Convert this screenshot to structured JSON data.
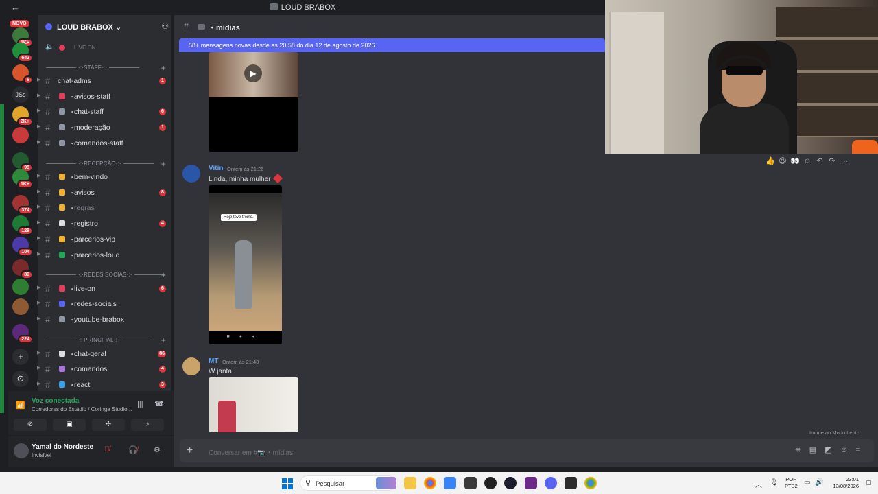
{
  "window": {
    "title": "LOUD BRABOX",
    "back_icon": "back-arrow-icon"
  },
  "rail": {
    "novo_label": "NOVO",
    "servers": [
      {
        "color": "#3c7a3e",
        "badge": "1K+"
      },
      {
        "color": "#1f8f3a",
        "badge": "642"
      },
      {
        "color": "#d8542a",
        "badge": "6"
      },
      {
        "color": "#e0a52a",
        "badge": "2K+"
      },
      {
        "color": "#c93a3a",
        "badge": ""
      },
      {
        "color": "#245a2f",
        "badge": "95"
      },
      {
        "color": "#2e8a3a",
        "badge": "1K+"
      },
      {
        "color": "#a13333",
        "badge": "374"
      },
      {
        "color": "#1f7a36",
        "badge": "128"
      },
      {
        "color": "#4b3aa8",
        "badge": "104"
      },
      {
        "color": "#7a2a2a",
        "badge": "80"
      },
      {
        "color": "#2e7d32",
        "badge": ""
      },
      {
        "color": "#8d5a34",
        "badge": ""
      },
      {
        "color": "#5b2a7a",
        "badge": "224"
      }
    ],
    "js_label": "JSs",
    "add_label": "+",
    "explore_label": "⊙"
  },
  "sidebar": {
    "server_name": "LOUD BRABOX",
    "live_on": "LIVE ON",
    "categories": [
      {
        "label": "STAFF"
      },
      {
        "label": "RECEPÇÃO"
      },
      {
        "label": "REDES SOCIAS"
      },
      {
        "label": "PRINCIPAL"
      }
    ],
    "channels": [
      {
        "label": "chat-adms",
        "count": "1",
        "emo": ""
      },
      {
        "label": "avisos-staff",
        "count": "",
        "emo": "#e23d5b"
      },
      {
        "label": "chat-staff",
        "count": "6",
        "emo": "#8f96a3"
      },
      {
        "label": "moderação",
        "count": "1",
        "emo": "#8f96a3"
      },
      {
        "label": "comandos-staff",
        "count": "",
        "emo": "#8f96a3"
      },
      {
        "label": "bem-vindo",
        "count": "",
        "emo": "#f0b232"
      },
      {
        "label": "avisos",
        "count": "8",
        "emo": "#f0b232"
      },
      {
        "label": "regras",
        "count": "",
        "emo": "#f0b232"
      },
      {
        "label": "registro",
        "count": "4",
        "emo": "#dbdee1"
      },
      {
        "label": "parcerios-vip",
        "count": "",
        "emo": "#f0b232"
      },
      {
        "label": "parcerios-loud",
        "count": "",
        "emo": "#23a55a"
      },
      {
        "label": "live-on",
        "count": "6",
        "emo": "#e23d5b"
      },
      {
        "label": "redes-sociais",
        "count": "",
        "emo": "#5865f2"
      },
      {
        "label": "youtube-brabox",
        "count": "",
        "emo": "#8f96a3"
      },
      {
        "label": "chat-geral",
        "count": "86",
        "emo": "#dbdee1"
      },
      {
        "label": "comandos",
        "count": "4",
        "emo": "#a974d8"
      },
      {
        "label": "react",
        "count": "3",
        "emo": "#3aa0e8"
      }
    ]
  },
  "voice": {
    "title": "Voz conectada",
    "subtitle": "Corredores do Estádio / Coringa Studio..."
  },
  "user": {
    "name": "Yamal do Nordeste",
    "status": "Invisível"
  },
  "main": {
    "channel_name": "mídias",
    "new_messages_banner": "58+ mensagens novas desde as 20:58 do dia 12 de agosto de 2026",
    "messages": [
      {
        "author": "Vitin",
        "time": "Ontem às 21:26",
        "text": "Linda, minha mulher",
        "author_color": "#5aa2ff",
        "media_caption": "Hoje teve treino."
      },
      {
        "author": "MT",
        "time": "Ontem às 21:48",
        "text": "W janta",
        "author_color": "#5aa2ff"
      }
    ],
    "slowmode": "Imune ao Modo Lento",
    "composer_placeholder": "Conversar em #📷・mídias"
  },
  "taskbar": {
    "search_label": "Pesquisar",
    "lang_top": "POR",
    "lang_bottom": "PTB2",
    "time": "23:01",
    "date": "13/08/2026"
  }
}
